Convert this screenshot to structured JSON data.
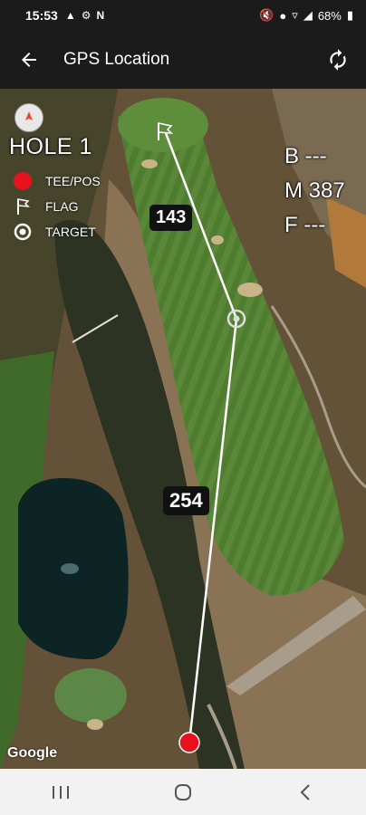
{
  "status_bar": {
    "time": "15:53",
    "battery": "68%",
    "left_icons": [
      "alert-icon",
      "settings-icon",
      "n-icon"
    ],
    "right_icons": [
      "mute-icon",
      "location-icon",
      "wifi-icon",
      "signal-icon",
      "battery-icon"
    ]
  },
  "app_bar": {
    "title": "GPS Location",
    "back_icon": "back-arrow-icon",
    "refresh_icon": "refresh-icon"
  },
  "map": {
    "hole_label": "HOLE 1",
    "legend": [
      {
        "label": "TEE/POS",
        "icon": "tee-position-icon"
      },
      {
        "label": "FLAG",
        "icon": "flag-icon"
      },
      {
        "label": "TARGET",
        "icon": "target-icon"
      }
    ],
    "distances": {
      "back": "B ---",
      "middle": "M 387",
      "front": "F ---"
    },
    "distance_to_flag": "143",
    "distance_to_target": "254",
    "attribution": "Google",
    "colors": {
      "tee_marker": "#e8121d",
      "line": "#ffffff",
      "fairway": "#4e7a2f"
    }
  },
  "nav_bar": {
    "recents_icon": "recents-icon",
    "home_icon": "home-icon",
    "back_icon": "nav-back-icon"
  }
}
